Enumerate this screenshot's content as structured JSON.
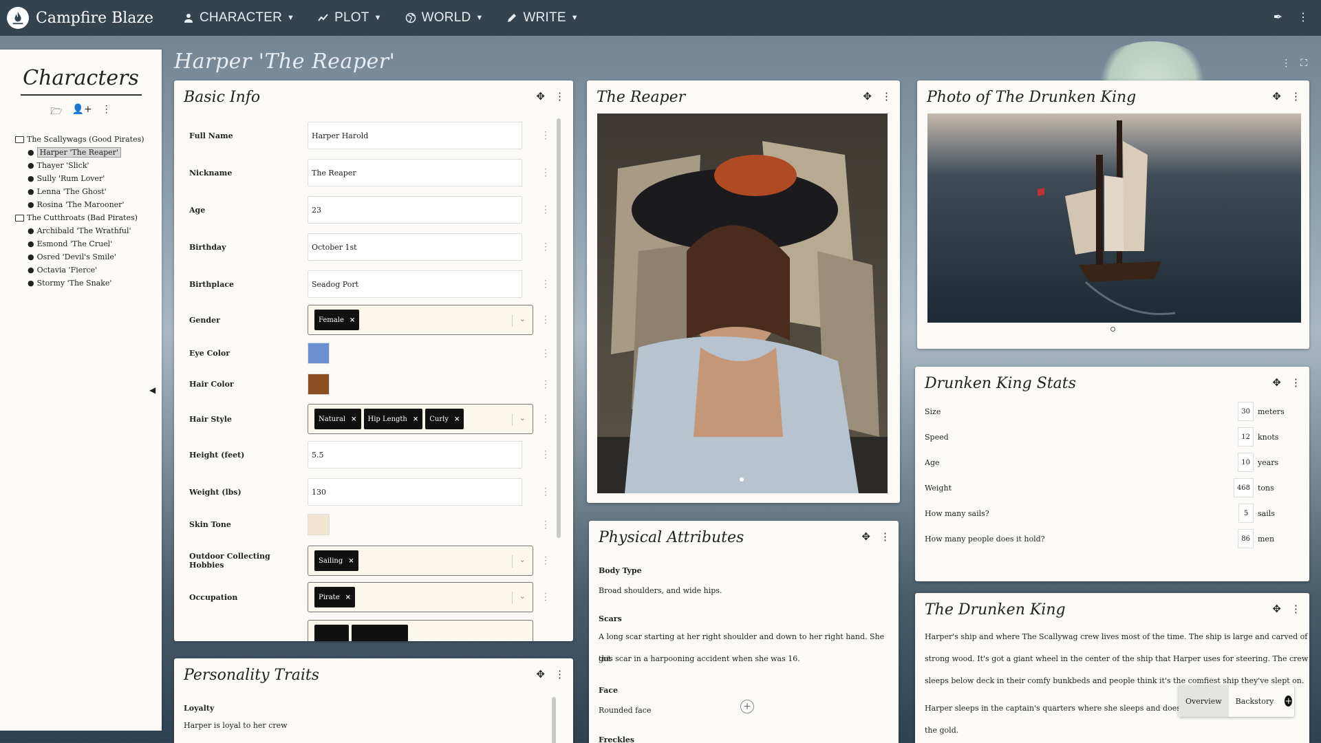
{
  "app": {
    "name": "Campfire Blaze"
  },
  "nav": [
    {
      "label": "CHARACTER",
      "icon": "person-icon"
    },
    {
      "label": "PLOT",
      "icon": "trend-icon"
    },
    {
      "label": "WORLD",
      "icon": "globe-icon"
    },
    {
      "label": "WRITE",
      "icon": "pencil-icon"
    }
  ],
  "sidebar": {
    "title": "Characters",
    "groups": [
      {
        "name": "The Scallywags (Good Pirates)",
        "items": [
          "Harper 'The Reaper'",
          "Thayer 'Slick'",
          "Sully 'Rum Lover'",
          "Lenna 'The Ghost'",
          "Rosina 'The Marooner'"
        ]
      },
      {
        "name": "The Cutthroats (Bad Pirates)",
        "items": [
          "Archibald 'The Wrathful'",
          "Esmond 'The Cruel'",
          "Osred 'Devil's Smile'",
          "Octavia 'Fierce'",
          "Stormy 'The Snake'"
        ]
      }
    ],
    "selected": "Harper 'The Reaper'"
  },
  "page": {
    "title": "Harper 'The Reaper'"
  },
  "basic_info": {
    "title": "Basic Info",
    "fields": {
      "full_name": {
        "label": "Full Name",
        "value": "Harper Harold"
      },
      "nickname": {
        "label": "Nickname",
        "value": "The Reaper"
      },
      "age": {
        "label": "Age",
        "value": "23"
      },
      "birthday": {
        "label": "Birthday",
        "value": "October 1st"
      },
      "birthplace": {
        "label": "Birthplace",
        "value": "Seadog Port"
      },
      "gender": {
        "label": "Gender",
        "chips": [
          "Female"
        ]
      },
      "eye_color": {
        "label": "Eye Color",
        "color": "#6b8fd1"
      },
      "hair_color": {
        "label": "Hair Color",
        "color": "#8b4f24"
      },
      "hair_style": {
        "label": "Hair Style",
        "chips": [
          "Natural",
          "Hip Length",
          "Curly"
        ]
      },
      "height": {
        "label": "Height (feet)",
        "value": "5.5"
      },
      "weight": {
        "label": "Weight (lbs)",
        "value": "130"
      },
      "skin_tone": {
        "label": "Skin Tone",
        "color": "#f2e6d2"
      },
      "hobbies": {
        "label": "Outdoor Collecting Hobbies",
        "chips": [
          "Sailing"
        ]
      },
      "occupation": {
        "label": "Occupation",
        "chips": [
          "Pirate"
        ]
      }
    }
  },
  "reaper_card": {
    "title": "The Reaper"
  },
  "photo_card": {
    "title": "Photo of The Drunken King"
  },
  "stats_card": {
    "title": "Drunken King Stats",
    "rows": [
      {
        "label": "Size",
        "value": "30",
        "unit": "meters"
      },
      {
        "label": "Speed",
        "value": "12",
        "unit": "knots"
      },
      {
        "label": "Age",
        "value": "10",
        "unit": "years"
      },
      {
        "label": "Weight",
        "value": "468",
        "unit": "tons"
      },
      {
        "label": "How many sails?",
        "value": "5",
        "unit": "sails"
      },
      {
        "label": "How many people does it hold?",
        "value": "86",
        "unit": "men"
      }
    ]
  },
  "physical_card": {
    "title": "Physical Attributes",
    "body_type_label": "Body Type",
    "body_type": "Broad shoulders, and wide hips.",
    "scars_label": "Scars",
    "scars_line1": "A long scar starting at her right shoulder and down to her right hand. She got",
    "scars_line2": "this scar in a harpooning accident when she was 16.",
    "face_label": "Face",
    "face": "Rounded face",
    "freckles_label": "Freckles"
  },
  "personality_card": {
    "title": "Personality Traits",
    "loyalty_label": "Loyalty",
    "loyalty": "Harper is loyal to her crew"
  },
  "drunken_king_card": {
    "title": "The Drunken King",
    "line1": "Harper's ship and where The Scallywag crew lives most of the time. The ship is large and carved of",
    "line2": "strong wood. It's got a giant wheel in the center of the ship that Harper uses for steering. The crew",
    "line3": "sleeps below deck in their comfy bunkbeds and people think it's the comfiest ship they've slept on.",
    "line4": "Harper sleeps in the captain's quarters where she sleeps and does all",
    "line5": "the gold.",
    "tabs": [
      "Overview",
      "Backstory"
    ],
    "active_tab": "Overview"
  }
}
